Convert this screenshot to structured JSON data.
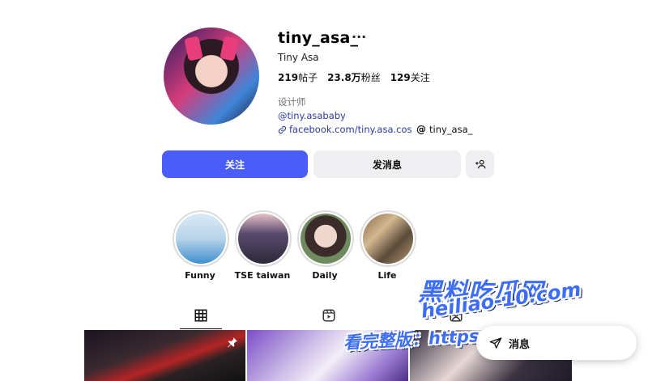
{
  "profile": {
    "username": "tiny_asa_",
    "more": "···",
    "full_name": "Tiny Asa",
    "stats": {
      "posts_value": "219",
      "posts_label": "帖子",
      "followers_value": "23.8万",
      "followers_label": "粉丝",
      "following_value": "129",
      "following_label": "关注"
    },
    "bio": {
      "category": "设计师",
      "handle": "@tiny.asababy",
      "link": "facebook.com/tiny.asa.cos",
      "threads": "tiny_asa_"
    }
  },
  "actions": {
    "follow": "关注",
    "message": "发消息",
    "add_user": "+♟"
  },
  "highlights": [
    {
      "label": "Funny"
    },
    {
      "label": "TSE taiwan"
    },
    {
      "label": "Daily"
    },
    {
      "label": "Life"
    }
  ],
  "overlay": {
    "site": "黑料吃瓜网",
    "url": "heiliao-10.com",
    "promo": "看完整版：https://"
  },
  "messages_pill": {
    "label": "消息"
  },
  "colors": {
    "accent": "#4a5df9",
    "secondary_button": "#efeff1",
    "link": "#2b3aa8"
  }
}
